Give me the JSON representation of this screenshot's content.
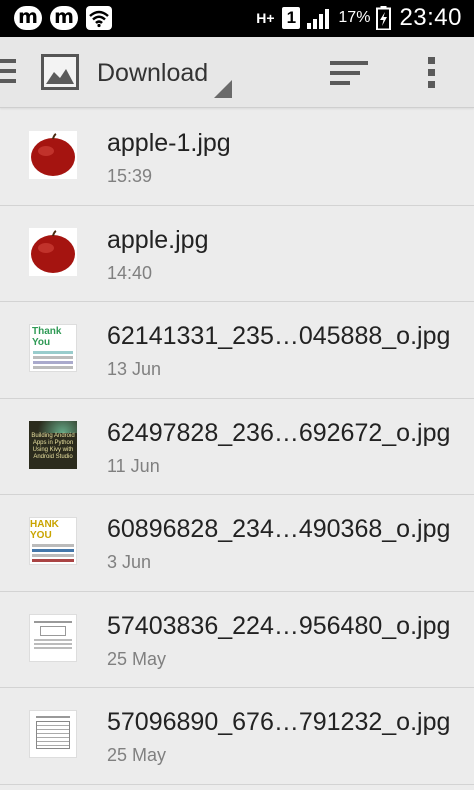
{
  "status_bar": {
    "network_type": "H+",
    "sim_slot": "1",
    "battery_percent": "17%",
    "time": "23:40"
  },
  "action_bar": {
    "title": "Download"
  },
  "files": [
    {
      "name": "apple-1.jpg",
      "date": "15:39",
      "thumb": "apple"
    },
    {
      "name": "apple.jpg",
      "date": "14:40",
      "thumb": "apple"
    },
    {
      "name": "62141331_235…045888_o.jpg",
      "date": "13 Jun",
      "thumb": "thank-you-green",
      "thumb_text": "Thank You"
    },
    {
      "name": "62497828_236…692672_o.jpg",
      "date": "11 Jun",
      "thumb": "book-cover",
      "thumb_text": "Building Android Apps in Python Using Kivy with Android Studio"
    },
    {
      "name": "60896828_234…490368_o.jpg",
      "date": "3 Jun",
      "thumb": "thank-you-yellow",
      "thumb_text": "HANK YOU"
    },
    {
      "name": "57403836_224…956480_o.jpg",
      "date": "25 May",
      "thumb": "document"
    },
    {
      "name": "57096890_676…791232_o.jpg",
      "date": "25 May",
      "thumb": "table-document"
    }
  ]
}
